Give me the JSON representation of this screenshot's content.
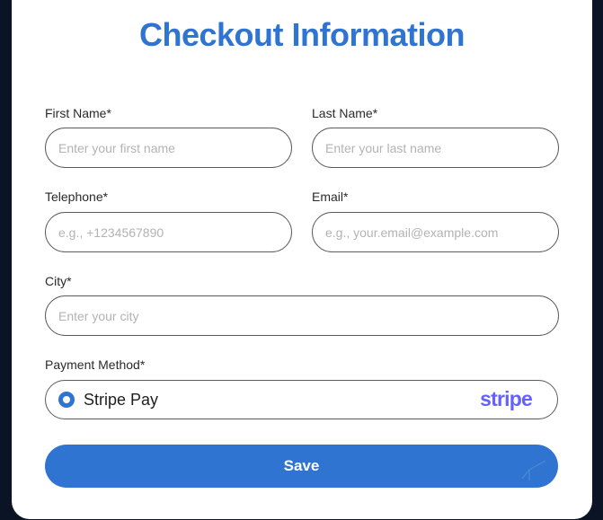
{
  "form": {
    "title": "Checkout Information",
    "first_name": {
      "label": "First Name*",
      "placeholder": "Enter your first name"
    },
    "last_name": {
      "label": "Last Name*",
      "placeholder": "Enter your last name"
    },
    "telephone": {
      "label": "Telephone*",
      "placeholder": "e.g., +1234567890"
    },
    "email": {
      "label": "Email*",
      "placeholder": "e.g., your.email@example.com"
    },
    "city": {
      "label": "City*",
      "placeholder": "Enter your city"
    },
    "payment": {
      "label": "Payment Method*",
      "option_label": "Stripe Pay",
      "logo_text": "stripe",
      "selected": true
    },
    "save_label": "Save"
  },
  "colors": {
    "accent": "#2f74d0",
    "stripe_brand": "#6461fc",
    "background": "#0b1424"
  },
  "icons": {
    "radio": "radio-selected-icon",
    "stripe": "stripe-logo-icon"
  }
}
